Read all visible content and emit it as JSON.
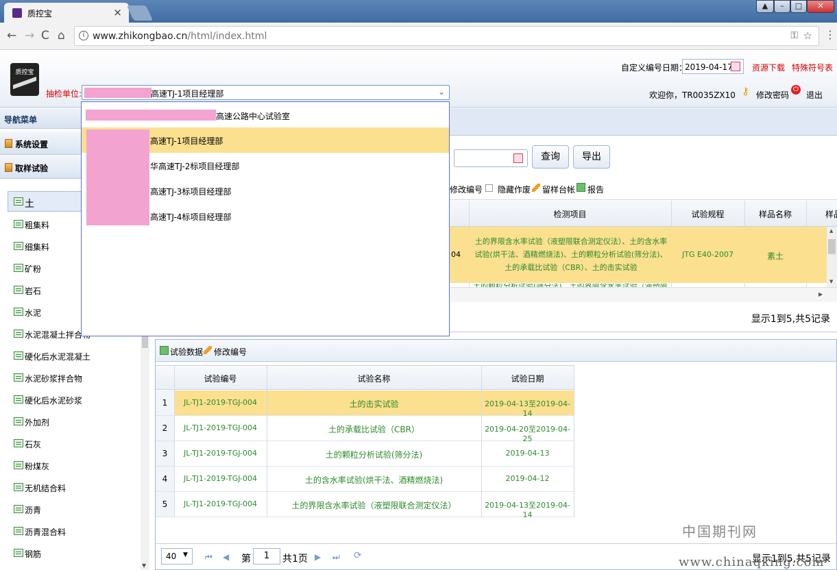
{
  "browser": {
    "tab_title": "质控宝",
    "tab_close": "×",
    "url_host": "www.zhikongbao.cn",
    "url_path": "/html/index.html",
    "info_icon": "i"
  },
  "header": {
    "logo_text": "质控宝",
    "date_label": "自定义编号日期：",
    "date_value": "2019-04-17",
    "resource_link": "资源下载",
    "special_link": "特殊符号表",
    "unit_label": "抽检单位:",
    "unit_value": "高速TJ-1项目经理部",
    "welcome": "欢迎你，TR0035ZX10",
    "change_pwd": "修改密码",
    "logout": "退出"
  },
  "dropdown": {
    "items": [
      {
        "label": "高速公路中心试验室",
        "selected": false
      },
      {
        "label": "高速TJ-1项目经理部",
        "selected": true
      },
      {
        "label": "华高速TJ-2标项目经理部",
        "selected": false
      },
      {
        "label": "高速TJ-3标项目经理部",
        "selected": false
      },
      {
        "label": "高速TJ-4标项目经理部",
        "selected": false
      }
    ]
  },
  "sidebar": {
    "title": "导航菜单",
    "sections": [
      "系统设置",
      "取样试验"
    ],
    "tree": [
      "土",
      "粗集料",
      "细集料",
      "矿粉",
      "岩石",
      "水泥",
      "水泥混凝土拌合物",
      "硬化后水泥混凝土",
      "水泥砂浆拌合物",
      "硬化后水泥砂浆",
      "外加剂",
      "石灰",
      "粉煤灰",
      "无机结合料",
      "沥青",
      "沥青混合料",
      "钢筋"
    ]
  },
  "search": {
    "query_button": "查询",
    "export_button": "导出"
  },
  "toolbar1": {
    "modify_no": "修改编号",
    "hide_void": "隐藏作废",
    "sample_ledger": "留样台帐",
    "report": "报告"
  },
  "grid1": {
    "headers": [
      "检测项目",
      "试验规程",
      "样品名称",
      "样品"
    ],
    "row": {
      "code_tail": "04",
      "items": "土的界限含水率试验（液塑限联合测定仪法）、土的含水率试验(烘干法、酒精燃烧法)、土的颗粒分析试验(筛分法)、土的承载比试验（CBR）、土的击实试验",
      "standard": "JTG E40-2007",
      "sample": "素土"
    },
    "next_row_partial": "土的颗粒分析试验(筛分法)、土的界限含水率试验（液塑限",
    "summary": "显示1到5,共5记录"
  },
  "panel2": {
    "toolbar_data": "试验数据",
    "toolbar_modify": "修改编号",
    "headers": [
      "试验编号",
      "试验名称",
      "试验日期"
    ],
    "rows": [
      {
        "n": "1",
        "code": "JL-TJ1-2019-TGJ-004",
        "name": "土的击实试验",
        "date": "2019-04-13至2019-04-14"
      },
      {
        "n": "2",
        "code": "JL-TJ1-2019-TGJ-004",
        "name": "土的承载比试验（CBR）",
        "date": "2019-04-20至2019-04-25"
      },
      {
        "n": "3",
        "code": "JL-TJ1-2019-TGJ-004",
        "name": "土的颗粒分析试验(筛分法)",
        "date": "2019-04-13"
      },
      {
        "n": "4",
        "code": "JL-TJ1-2019-TGJ-004",
        "name": "土的含水率试验(烘干法、酒精燃烧法)",
        "date": "2019-04-12"
      },
      {
        "n": "5",
        "code": "JL-TJ1-2019-TGJ-004",
        "name": "土的界限含水率试验（液塑限联合测定仪法）",
        "date": "2019-04-13至2019-04-14"
      }
    ],
    "page_size": "40",
    "page_prefix": "第",
    "page_value": "1",
    "page_total": "共1页",
    "summary": "显示1到5,共5记录"
  },
  "watermark": {
    "line1": "中国期刊网",
    "line2": "www.chinaqking.com"
  },
  "colors": {
    "selected_row": "#fbe08f",
    "link_red": "#d40000",
    "data_green": "#2c8a2c"
  }
}
